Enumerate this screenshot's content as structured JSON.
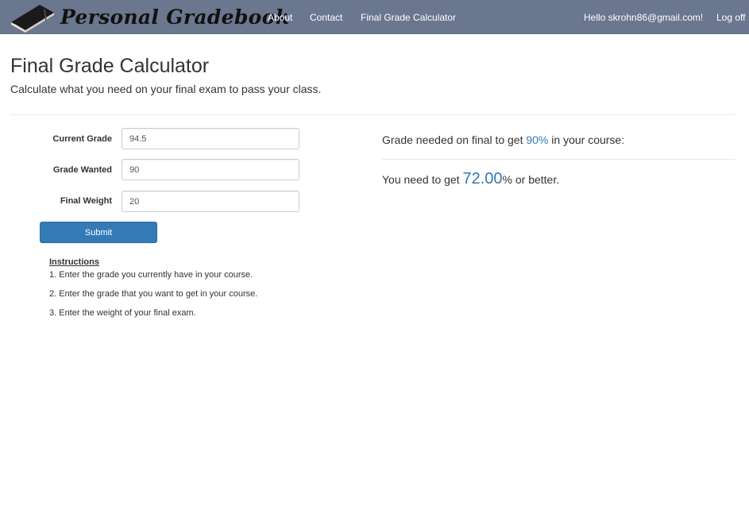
{
  "navbar": {
    "brand": "Personal Gradebook",
    "links": [
      "About",
      "Contact",
      "Final Grade Calculator"
    ],
    "greeting": "Hello skrohn86@gmail.com!",
    "logoff": "Log off",
    "background_color": "#6b778f",
    "logo_icon": "book-icon"
  },
  "page": {
    "title": "Final Grade Calculator",
    "subtitle": "Calculate what you need on your final exam to pass your class."
  },
  "form": {
    "current_grade": {
      "label": "Current Grade",
      "value": "94.5"
    },
    "grade_wanted": {
      "label": "Grade Wanted",
      "value": "90"
    },
    "final_weight": {
      "label": "Final Weight",
      "value": "20"
    },
    "submit_label": "Submit",
    "button_color": "#337ab7"
  },
  "instructions": {
    "title": "Instructions",
    "items": [
      "1. Enter the grade you currently have in your course.",
      "2. Enter the grade that you want to get in your course.",
      "3. Enter the weight of your final exam."
    ]
  },
  "result": {
    "heading_prefix": "Grade needed on final to get ",
    "target_percent": "90%",
    "heading_suffix": " in your course:",
    "line_prefix": "You need to get ",
    "needed_value": "72.00",
    "line_suffix": "% or better.",
    "accent_color": "#337ab7"
  }
}
